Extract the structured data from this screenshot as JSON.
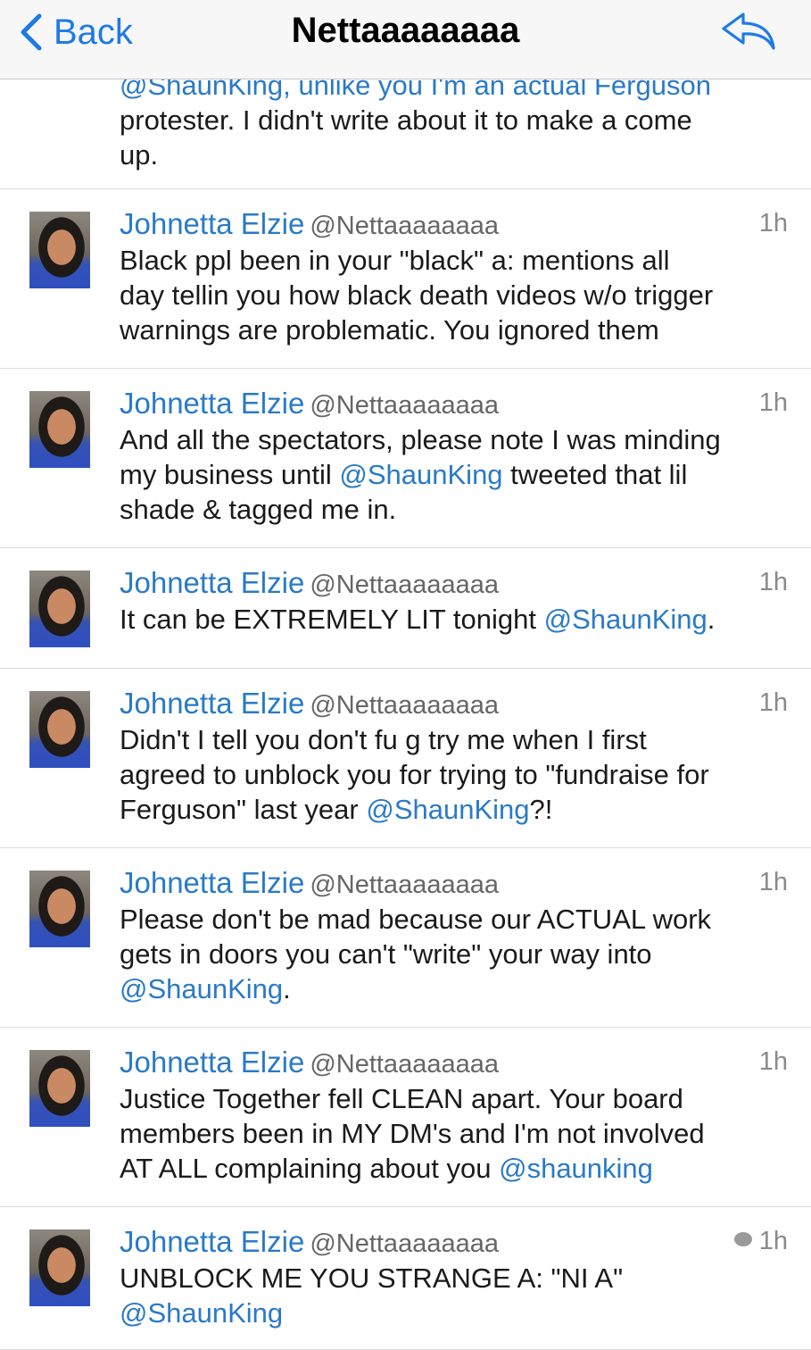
{
  "nav": {
    "back_label": "Back",
    "title": "Nettaaaaaaaa"
  },
  "partial_tweet": {
    "line1": "@ShaunKing, unlike you I'm an actual Ferguson",
    "line2": "protester. I didn't write about it to make a come",
    "line3": "up."
  },
  "tweets": [
    {
      "name": "Johnetta Elzie",
      "handle": "@Nettaaaaaaaa",
      "time": "1h",
      "parts": [
        {
          "t": "Black ppl been in your \"black\" a:    mentions all\nday tellin you how black death videos w/o trigger\nwarnings are problematic. You ignored them"
        }
      ]
    },
    {
      "name": "Johnetta Elzie",
      "handle": "@Nettaaaaaaaa",
      "time": "1h",
      "parts": [
        {
          "t": "And all the spectators, please note I was minding\nmy business until "
        },
        {
          "t": "@ShaunKing",
          "m": true
        },
        {
          "t": " tweeted that lil\nshade & tagged me in."
        }
      ]
    },
    {
      "name": "Johnetta Elzie",
      "handle": "@Nettaaaaaaaa",
      "time": "1h",
      "parts": [
        {
          "t": "It can be EXTREMELY LIT tonight "
        },
        {
          "t": "@ShaunKing",
          "m": true
        },
        {
          "t": "."
        }
      ]
    },
    {
      "name": "Johnetta Elzie",
      "handle": "@Nettaaaaaaaa",
      "time": "1h",
      "parts": [
        {
          "t": "Didn't I tell you don't fu       g try me when I first\nagreed to unblock you for trying to \"fundraise for\nFerguson\" last year "
        },
        {
          "t": "@ShaunKing",
          "m": true
        },
        {
          "t": "?!"
        }
      ]
    },
    {
      "name": "Johnetta Elzie",
      "handle": "@Nettaaaaaaaa",
      "time": "1h",
      "parts": [
        {
          "t": "Please don't be mad because our ACTUAL work\ngets in doors you can't \"write\" your way into\n"
        },
        {
          "t": "@ShaunKing",
          "m": true
        },
        {
          "t": "."
        }
      ]
    },
    {
      "name": "Johnetta Elzie",
      "handle": "@Nettaaaaaaaa",
      "time": "1h",
      "parts": [
        {
          "t": "Justice Together fell CLEAN apart. Your board\nmembers been in MY DM's and I'm not involved\nAT ALL complaining about you "
        },
        {
          "t": "@shaunking",
          "m": true
        }
      ]
    },
    {
      "name": "Johnetta Elzie",
      "handle": "@Nettaaaaaaaa",
      "time": "1h",
      "has_reply_icon": true,
      "parts": [
        {
          "t": "UNBLOCK ME YOU STRANGE A:      \"NI      A\"\n"
        },
        {
          "t": "@ShaunKing",
          "m": true
        }
      ]
    }
  ],
  "colors": {
    "accent": "#1f7ae6",
    "name": "#2a7ac6",
    "mention": "#2a7ac6",
    "divider": "#dcdcdc"
  }
}
